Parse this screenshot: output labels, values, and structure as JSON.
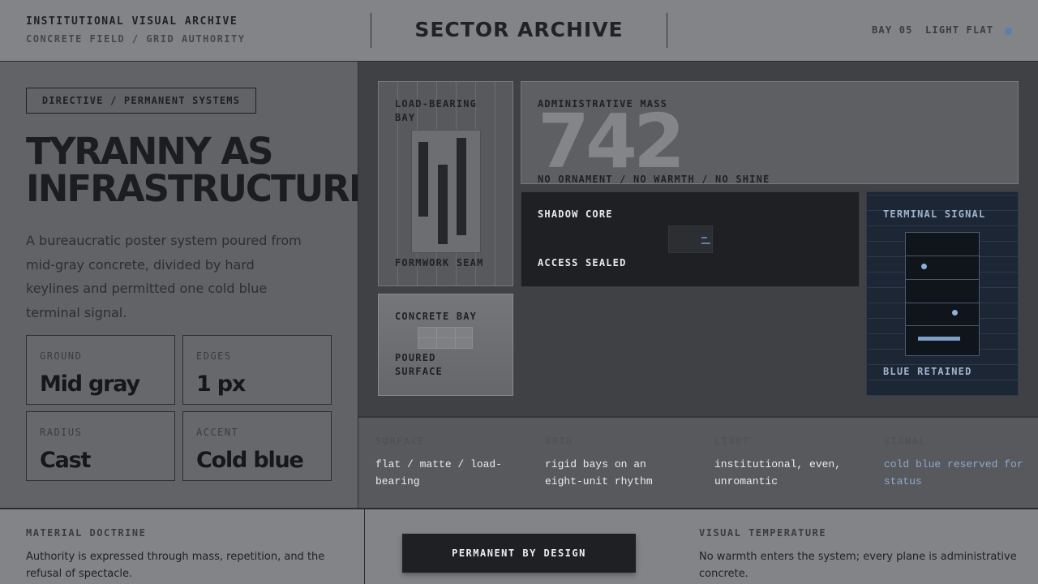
{
  "header": {
    "kicker_line1": "INSTITUTIONAL VISUAL ARCHIVE",
    "kicker_line2": "CONCRETE FIELD / GRID AUTHORITY",
    "brand": "SECTOR ARCHIVE",
    "bay": "BAY 05",
    "light": "LIGHT FLAT",
    "status_color": "#5b7fb5"
  },
  "hero": {
    "badge": "DIRECTIVE / PERMANENT SYSTEMS",
    "title_line1": "TYRANNY AS",
    "title_line2": "INFRASTRUCTURE",
    "lead": "A bureaucratic poster system poured from mid-gray concrete, divided by hard keylines and permitted one cold blue terminal signal.",
    "stats": [
      {
        "label": "GROUND",
        "value": "Mid gray"
      },
      {
        "label": "EDGES",
        "value": "1 px"
      },
      {
        "label": "RADIUS",
        "value": "Cast"
      },
      {
        "label": "ACCENT",
        "value": "Cold blue"
      }
    ]
  },
  "tiles": {
    "load_bearing": {
      "label": "LOAD-BEARING BAY",
      "caption": "FORMWORK SEAM"
    },
    "admin": {
      "label": "ADMINISTRATIVE MASS",
      "number": "742",
      "caption": "NO ORNAMENT / NO WARMTH / NO SHINE"
    },
    "shadow": {
      "label": "SHADOW CORE",
      "caption": "ACCESS SEALED"
    },
    "terminal": {
      "label": "TERMINAL SIGNAL",
      "caption": "BLUE RETAINED"
    },
    "concrete": {
      "label": "CONCRETE BAY",
      "caption": "POURED SURFACE"
    }
  },
  "specs": [
    {
      "label": "SURFACE",
      "value": "flat / matte / load-bearing"
    },
    {
      "label": "GRID",
      "value": "rigid bays on an eight-unit rhythm"
    },
    {
      "label": "LIGHT",
      "value": "institutional, even, unromantic"
    },
    {
      "label": "SIGNAL",
      "value": "cold blue reserved for status"
    }
  ],
  "footer": {
    "doctrine_label": "MATERIAL DOCTRINE",
    "doctrine_text": "Authority is expressed through mass, repetition, and the refusal of spectacle.",
    "cta": "PERMANENT BY DESIGN",
    "temperature_label": "VISUAL TEMPERATURE",
    "temperature_text": "No warmth enters the system; every plane is administrative concrete."
  }
}
